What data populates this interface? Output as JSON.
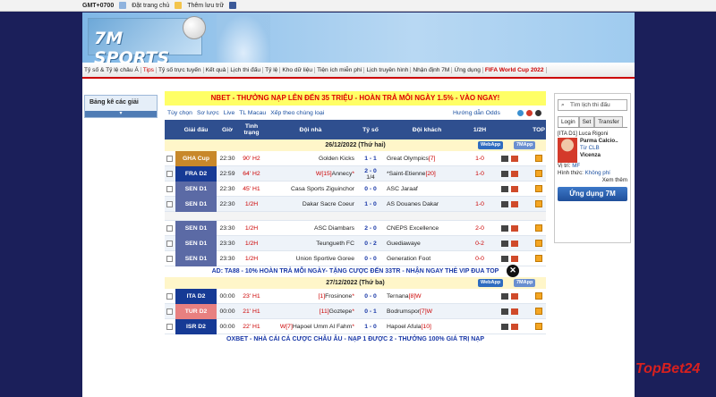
{
  "topbar": {
    "gmt": "GMT+0700",
    "home": "Đặt trang chủ",
    "fav": "Thêm lưu trữ"
  },
  "logo": "7M SPORTS",
  "nav": [
    "Tỷ số & Tỷ lệ châu Á",
    "Tips",
    "Tỷ số trực tuyến",
    "Kết quả",
    "Lịch thi đấu",
    "Tỷ lệ",
    "Kho dữ liệu",
    "Tiện ích miễn phí",
    "Lịch truyền hình",
    "Nhận định 7M",
    "Ứng dụng",
    "FIFA World Cup 2022"
  ],
  "left": {
    "title": "Bảng kê các giải"
  },
  "promo_top": "NBET - THƯỞNG NẠP LÊN ĐẾN 35 TRIỆU - HOÀN TRẢ MỖI NGÀY 1.5% - VÀO NGAY!",
  "tools": [
    "Tùy chọn",
    "Sơ lược",
    "Live",
    "TL Macau",
    "Xếp theo chùng loại"
  ],
  "guide": "Hướng dẫn Odds",
  "header": {
    "league": "Giải đấu",
    "time": "Giờ",
    "status": "Tình trạng",
    "home": "Đội nhà",
    "score": "Tỷ số",
    "away": "Đội khách",
    "half": "1/2H",
    "top": "TOP"
  },
  "badges": {
    "webapp": "WebApp",
    "app": "7MApp"
  },
  "date1": "26/12/2022 (Thứ hai)",
  "date2": "27/12/2022 (Thứ ba)",
  "group1": [
    {
      "league": "GHA Cup",
      "color": "#c8882a",
      "time": "22:30",
      "status": "90' H2",
      "home": "Golden Kicks",
      "score": "1 - 1",
      "away": "Great Olympics",
      "away_r": "[7]",
      "half": "1-0"
    },
    {
      "league": "FRA D2",
      "color": "#163a95",
      "time": "22:59",
      "status": "64' H2",
      "home_r": "W[15]",
      "home": "Annecy",
      "home_star": "*",
      "score": "2 - 0",
      "score2": "1/4",
      "away": "*Saint-Etienne",
      "away_r": "[20]",
      "half": "1-0"
    },
    {
      "league": "SEN D1",
      "color": "#5b6aa5",
      "time": "22:30",
      "status": "45' H1",
      "home": "Casa Sports Ziguinchor",
      "score": "0 - 0",
      "away": "ASC Jaraaf",
      "half": ""
    },
    {
      "league": "SEN D1",
      "color": "#5b6aa5",
      "time": "22:30",
      "status": "1/2H",
      "home": "Dakar Sacre Coeur",
      "score": "1 - 0",
      "away": "AS Douanes Dakar",
      "half": "1-0"
    }
  ],
  "group2": [
    {
      "league": "SEN D1",
      "color": "#5b6aa5",
      "time": "23:30",
      "status": "1/2H",
      "home": "ASC Diambars",
      "score": "2 - 0",
      "away": "CNEPS Excellence",
      "half": "2-0"
    },
    {
      "league": "SEN D1",
      "color": "#5b6aa5",
      "time": "23:30",
      "status": "1/2H",
      "home": "Teungueth FC",
      "score": "0 - 2",
      "away": "Guediawaye",
      "half": "0-2"
    },
    {
      "league": "SEN D1",
      "color": "#5b6aa5",
      "time": "23:30",
      "status": "1/2H",
      "home": "Union Sportive Goree",
      "score": "0 - 0",
      "away": "Generation Foot",
      "half": "0-0"
    }
  ],
  "ad1": "AD: TA88 - 10% HOÀN TRẢ MỖI NGÀY- TẶNG CƯỢC ĐẾN 33TR - NHẬN NGAY THẺ VIP ĐUA TOP",
  "group3": [
    {
      "league": "ITA D2",
      "color": "#163a95",
      "time": "00:00",
      "status": "23' H1",
      "home_r": "[1]",
      "home": "Frosinone",
      "home_star": "*",
      "score": "0 - 0",
      "away": "Ternana",
      "away_r": "[8]W",
      "half": ""
    },
    {
      "league": "TUR D2",
      "color": "#e88080",
      "time": "00:00",
      "status": "21' H1",
      "home_r": "[11]",
      "home": "Goztepe",
      "home_star": "*",
      "score": "0 - 1",
      "away": "Bodrumspor",
      "away_r": "[7]W",
      "half": ""
    },
    {
      "league": "ISR D2",
      "color": "#163a95",
      "time": "00:00",
      "status": "22' H1",
      "home_r": "W[7]",
      "home": "Hapoel Umm Al Fahm",
      "home_star": "*",
      "score": "1 - 0",
      "away": "Hapoel Afula",
      "away_r": "[10]",
      "half": ""
    }
  ],
  "ad2": "OXBET - NHÀ CÁI CÁ CƯỢC CHÂU ÂU - NẠP 1 ĐƯỢC 2 - THƯỞNG 100% GIÁ TRỊ NẠP",
  "right": {
    "search": "Tìm lịch thi đấu",
    "tabs": [
      "Login",
      "Set",
      "Transfer"
    ],
    "player_league": "[ITA D1] Luca Rigoni",
    "club_label": "Parma Calcio..",
    "from": "Từ CLB",
    "new_club": "Vicenza",
    "pos_label": "Vị trí:",
    "pos": "MF",
    "form_label": "Hình thức:",
    "form": "Không phí",
    "more": "Xem thêm",
    "app": "Ứng dụng 7M"
  },
  "watermark": "TopBet24"
}
